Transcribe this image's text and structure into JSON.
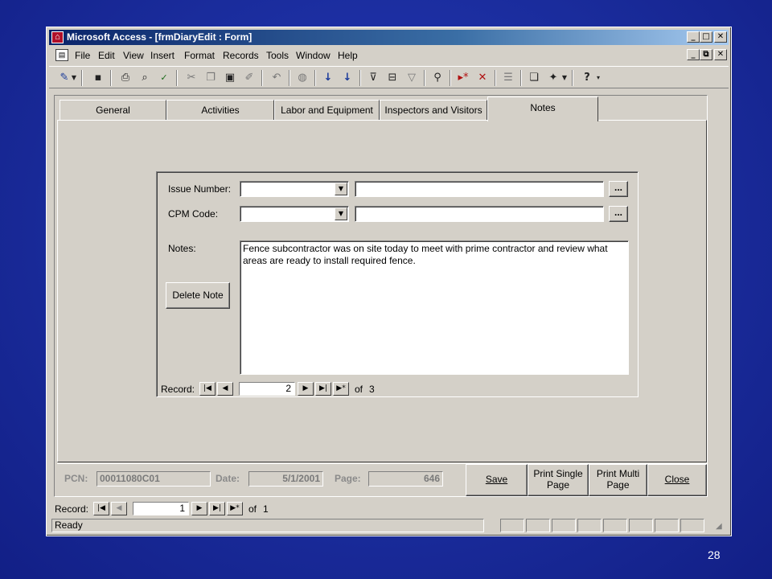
{
  "window": {
    "title": "Microsoft Access - [frmDiaryEdit : Form]",
    "app_icon": "access-key-icon",
    "caption_buttons": [
      "_",
      "□",
      "X"
    ],
    "mdi_buttons": [
      "_",
      "⧉",
      "X"
    ]
  },
  "menu": {
    "items": [
      {
        "label": "File"
      },
      {
        "label": "Edit"
      },
      {
        "label": "View"
      },
      {
        "label": "Insert"
      },
      {
        "label": "Format"
      },
      {
        "label": "Records"
      },
      {
        "label": "Tools"
      },
      {
        "label": "Window"
      },
      {
        "label": "Help"
      }
    ]
  },
  "toolbar": {
    "icons": [
      "design-view-icon",
      "save-icon",
      "print-icon",
      "print-preview-icon",
      "spelling-icon",
      "cut-icon",
      "copy-icon",
      "paste-icon",
      "format-painter-icon",
      "undo-icon",
      "hyperlink-icon",
      "sort-ascending-icon",
      "sort-descending-icon",
      "filter-by-selection-icon",
      "filter-by-form-icon",
      "apply-filter-icon",
      "find-icon",
      "new-record-icon",
      "delete-record-icon",
      "properties-icon",
      "database-window-icon",
      "new-object-icon",
      "help-icon"
    ]
  },
  "tabs": [
    {
      "label": "General"
    },
    {
      "label": "Activities"
    },
    {
      "label": "Labor and Equipment"
    },
    {
      "label": "Inspectors and Visitors"
    },
    {
      "label": "Notes"
    }
  ],
  "notes_form": {
    "issue_number_label": "Issue Number:",
    "cpm_code_label": "CPM Code:",
    "notes_label": "Notes:",
    "ellipsis": "...",
    "delete_button": "Delete Note",
    "notes_text": "Fence subcontractor was on site today to meet with prime contractor and review what areas are ready to install required fence.",
    "nav": {
      "label": "Record:",
      "current": "2",
      "of_label": "of",
      "total": "3"
    }
  },
  "footer": {
    "pcn_label": "PCN:",
    "pcn_value": "00011080C01",
    "date_label": "Date:",
    "date_value": "5/1/2001",
    "page_label": "Page:",
    "page_value": "646",
    "save_button": "Save",
    "print_single_button": "Print Single Page",
    "print_multi_button": "Print Multi Page",
    "close_button": "Close"
  },
  "main_nav": {
    "label": "Record:",
    "current": "1",
    "of_label": "of",
    "total": "1"
  },
  "status": {
    "text": "Ready"
  },
  "slide_number": "28"
}
